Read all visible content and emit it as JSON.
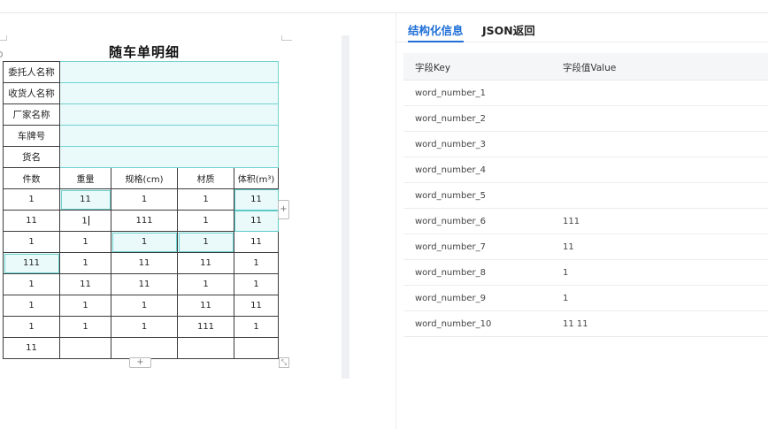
{
  "document": {
    "title": "随车单明细",
    "info_rows": [
      {
        "label": "委托人名称"
      },
      {
        "label": "收货人名称"
      },
      {
        "label": "厂家名称"
      },
      {
        "label": "车牌号"
      },
      {
        "label": "货名"
      }
    ],
    "table_headers": [
      "件数",
      "重量",
      "规格(cm)",
      "材质",
      "体积(m³)"
    ],
    "table_rows": [
      [
        "1",
        "11",
        "1",
        "1",
        "11"
      ],
      [
        "11",
        "1",
        "111",
        "1",
        "11"
      ],
      [
        "1",
        "1",
        "1",
        "1",
        "11"
      ],
      [
        "111",
        "1",
        "11",
        "11",
        "1"
      ],
      [
        "1",
        "11",
        "11",
        "1",
        "1"
      ],
      [
        "1",
        "1",
        "1",
        "11",
        "11"
      ],
      [
        "1",
        "1",
        "1",
        "111",
        "1"
      ],
      [
        "11",
        "",
        "",
        "",
        ""
      ]
    ],
    "add_column_label": "+",
    "add_row_label": "+",
    "resize_label": "⤡"
  },
  "tabs": [
    {
      "label": "结构化信息",
      "active": true
    },
    {
      "label": "JSON返回",
      "active": false
    }
  ],
  "kv_table": {
    "header_key": "字段Key",
    "header_value": "字段值Value",
    "rows": [
      {
        "key": "word_number_1",
        "value": ""
      },
      {
        "key": "word_number_2",
        "value": ""
      },
      {
        "key": "word_number_3",
        "value": ""
      },
      {
        "key": "word_number_4",
        "value": ""
      },
      {
        "key": "word_number_5",
        "value": ""
      },
      {
        "key": "word_number_6",
        "value": "111"
      },
      {
        "key": "word_number_7",
        "value": "11"
      },
      {
        "key": "word_number_8",
        "value": "1"
      },
      {
        "key": "word_number_9",
        "value": "1"
      },
      {
        "key": "word_number_10",
        "value": "11 11"
      }
    ]
  },
  "colors": {
    "accent": "#1f6fd6",
    "highlight_fill": "#eafafa",
    "highlight_border": "#6fd3d0"
  }
}
